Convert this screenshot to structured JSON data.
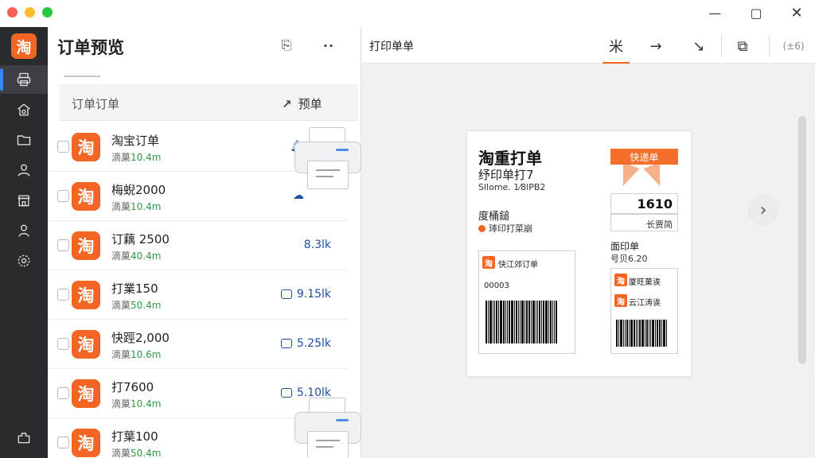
{
  "window": {
    "minimize": "—",
    "maximize": "▢",
    "close": "✕"
  },
  "sidebar": {
    "logo": "淘",
    "items": [
      "printer-icon",
      "home-gear-icon",
      "folder-icon",
      "user-icon",
      "store-icon",
      "person-icon",
      "settings-icon"
    ],
    "bottom_icon": "plugin-icon"
  },
  "list_panel": {
    "title": "订单预览",
    "share_icon": "⎘",
    "more_icon": "··",
    "header_label": "订单订单",
    "header_right_icon": "↗",
    "header_right_label": "预单",
    "rows": [
      {
        "logo": "淘",
        "name": "淘宝订单",
        "sub_prefix": "滴菓",
        "sub_value": "10.4m",
        "value": "",
        "icon": "bell"
      },
      {
        "logo": "淘",
        "name": "梅蜺2000",
        "sub_prefix": "滴菓",
        "sub_value": "10.4m",
        "value": "",
        "icon": "cloud"
      },
      {
        "logo": "淘",
        "name": "订藕 2500",
        "sub_prefix": "滴菓",
        "sub_value": "40.4m",
        "value": "8.3lk",
        "icon": ""
      },
      {
        "logo": "淘",
        "name": "打業150",
        "sub_prefix": "滴菓",
        "sub_value": "50.4m",
        "value": "9.15lk",
        "icon": "box"
      },
      {
        "logo": "淘",
        "name": "快踁2,000",
        "sub_prefix": "滴菓",
        "sub_value": "10.6m",
        "value": "5.25lk",
        "icon": "box"
      },
      {
        "logo": "淘",
        "name": "打7600",
        "sub_prefix": "滴菓",
        "sub_value": "10.4m",
        "value": "5.10lk",
        "icon": "box"
      },
      {
        "logo": "淘",
        "name": "打葉100",
        "sub_prefix": "滴菓",
        "sub_value": "50.4m",
        "value": "",
        "icon": ""
      }
    ]
  },
  "preview": {
    "title": "打印单单",
    "tools": [
      "米",
      "→",
      "↘",
      "⧉",
      "(zoom)"
    ],
    "zoom_text": "(±6)",
    "next": "›",
    "card": {
      "title": "淘重打单",
      "subtitle": "纾印单打7",
      "meta": "Sllome. 1⁄8lPB2",
      "ribbon": "快递单",
      "amount": "1610",
      "amount_sub": "长贾简",
      "label1": "度桶鎚",
      "label2": "琫印打菜崩",
      "label3": "面印单",
      "label4": "号贝6.20",
      "slip_a_title": "快江郊订单",
      "slip_a_code": "00003",
      "slip_b_line1": "厦旺菓诶",
      "slip_b_line2": "云江涛诶"
    }
  }
}
